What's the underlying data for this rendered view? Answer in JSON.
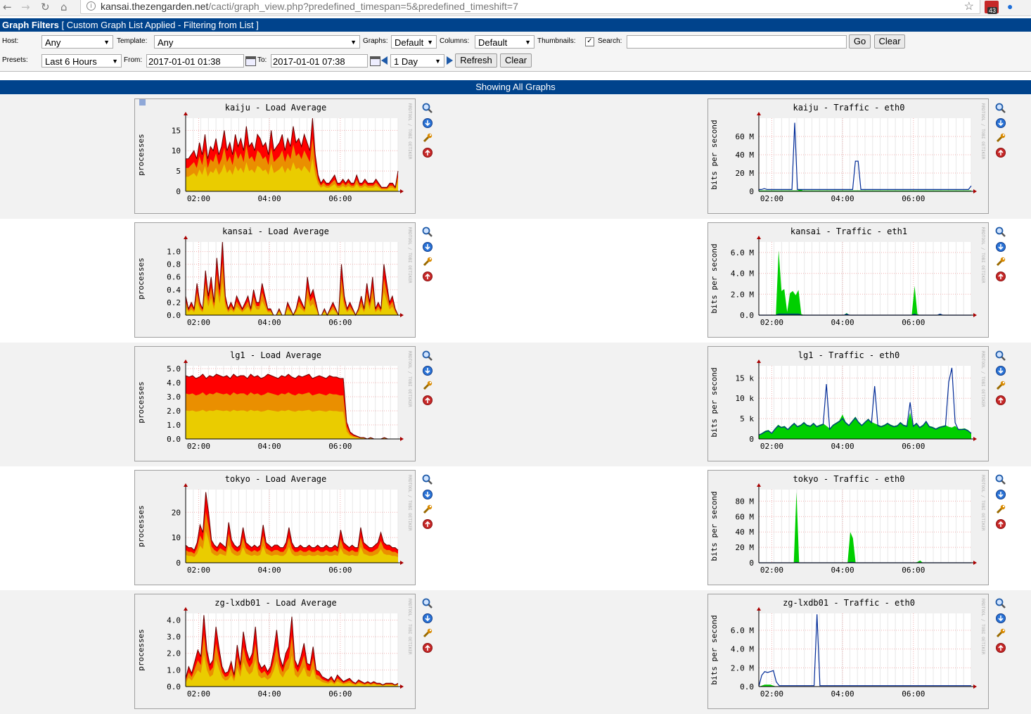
{
  "browser": {
    "url_host": "kansai.thezengarden.net",
    "url_path": "/cacti/graph_view.php?predefined_timespan=5&predefined_timeshift=7",
    "ext_badge": "43",
    "nav": {
      "back": "←",
      "forward": "→",
      "reload": "↻",
      "home": "⌂",
      "info": "i",
      "star": "☆"
    }
  },
  "filters": {
    "title": "Graph Filters",
    "subtitle": "[ Custom Graph List Applied - Filtering from List ]",
    "host_label": "Host:",
    "host_value": "Any",
    "template_label": "Template:",
    "template_value": "Any",
    "graphs_label": "Graphs:",
    "graphs_value": "Default",
    "columns_label": "Columns:",
    "columns_value": "Default",
    "thumbnails_label": "Thumbnails:",
    "thumbnails_checked": true,
    "search_label": "Search:",
    "search_value": "",
    "go_label": "Go",
    "clear_label": "Clear",
    "presets_label": "Presets:",
    "presets_value": "Last 6 Hours",
    "from_label": "From:",
    "from_value": "2017-01-01 01:38",
    "to_label": "To:",
    "to_value": "2017-01-01 07:38",
    "shift_value": "1 Day",
    "refresh_label": "Refresh",
    "clear2_label": "Clear"
  },
  "showing_label": "Showing All Graphs",
  "rrd_watermark": "RRDTOOL / TOBI OETIKER",
  "time_ticks": [
    "02:00",
    "04:00",
    "06:00"
  ],
  "colors": {
    "header": "#00438c",
    "load_red": "#ff0000",
    "load_orange": "#ea8f00",
    "load_yellow": "#eacc00",
    "traffic_in": "#00cf00",
    "traffic_out": "#002a97"
  },
  "icons": [
    "zoom-icon",
    "csv-export-icon",
    "edit-graph-icon",
    "top-icon"
  ],
  "graphs": [
    {
      "host": "kaiju",
      "left_title": "kaiju  -  Load Average",
      "right_title": "kaiju  -  Traffic  -  eth0",
      "left_ylabel": "processes",
      "right_ylabel": "bits per second",
      "left_ticks": [
        "0",
        "5",
        "10",
        "15"
      ],
      "left_ymax": 18,
      "right_ticks": [
        "0",
        "20 M",
        "40 M",
        "60 M"
      ],
      "right_ymax": 80,
      "load": [
        8,
        8,
        9,
        10,
        8,
        12,
        9,
        14,
        8,
        11,
        10,
        13,
        9,
        11,
        15,
        10,
        12,
        9,
        14,
        11,
        13,
        10,
        16,
        11,
        12,
        10,
        14,
        13,
        11,
        12,
        9,
        15,
        10,
        11,
        12,
        14,
        10,
        13,
        11,
        16,
        12,
        13,
        11,
        14,
        12,
        10,
        18,
        9,
        4,
        2,
        3,
        2,
        2,
        3,
        4,
        2,
        2,
        3,
        2,
        3,
        2,
        2,
        4,
        2,
        2,
        3,
        2,
        2,
        2,
        3,
        2,
        1,
        1,
        1,
        2,
        2,
        1,
        5
      ],
      "traffic_in": [
        1,
        1,
        1,
        1,
        1,
        1,
        1,
        1,
        1,
        1,
        1,
        1,
        1,
        1,
        1,
        2,
        1,
        1,
        1,
        1,
        1,
        1,
        1,
        1,
        1,
        1,
        1,
        1,
        1,
        1,
        1,
        1,
        1,
        1,
        1,
        1,
        1,
        1,
        1,
        1,
        1,
        1,
        1,
        1,
        1,
        1,
        1,
        1,
        1,
        1,
        1,
        1,
        1,
        1,
        1,
        1,
        1,
        1,
        1,
        1,
        1,
        1,
        1,
        1,
        1,
        1,
        1,
        1,
        1,
        1,
        1,
        1,
        1,
        1,
        1,
        1,
        1,
        1
      ],
      "traffic_out": [
        2,
        2,
        3,
        2,
        2,
        2,
        2,
        2,
        2,
        2,
        2,
        2,
        2,
        75,
        2,
        2,
        2,
        2,
        2,
        2,
        2,
        2,
        2,
        2,
        2,
        2,
        2,
        2,
        2,
        2,
        2,
        2,
        2,
        2,
        2,
        33,
        33,
        2,
        2,
        2,
        2,
        2,
        2,
        2,
        2,
        2,
        2,
        2,
        2,
        2,
        2,
        2,
        2,
        2,
        2,
        2,
        2,
        2,
        2,
        2,
        2,
        2,
        2,
        2,
        2,
        2,
        2,
        2,
        2,
        2,
        2,
        2,
        2,
        2,
        2,
        2,
        2,
        6
      ]
    },
    {
      "host": "kansai",
      "left_title": "kansai  -  Load Average",
      "right_title": "kansai  -  Traffic  -  eth1",
      "left_ylabel": "processes",
      "right_ylabel": "bits per second",
      "left_ticks": [
        "0.0",
        "0.2",
        "0.4",
        "0.6",
        "0.8",
        "1.0"
      ],
      "left_ymax": 1.15,
      "right_ticks": [
        "0.0",
        "2.0 M",
        "4.0 M",
        "6.0 M"
      ],
      "right_ymax": 7,
      "load": [
        0.3,
        0.1,
        0.2,
        0.1,
        0.5,
        0.2,
        0.1,
        0.7,
        0.3,
        0.6,
        0.2,
        0.9,
        0.4,
        1.15,
        0.3,
        0.1,
        0.2,
        0.1,
        0.3,
        0.2,
        0.1,
        0.2,
        0.3,
        0.1,
        0.4,
        0.2,
        0.2,
        0.5,
        0.3,
        0.1,
        0.1,
        0.0,
        0.0,
        0.1,
        0.0,
        0.0,
        0.2,
        0.1,
        0.0,
        0.1,
        0.3,
        0.2,
        0.1,
        0.6,
        0.3,
        0.4,
        0.2,
        0.0,
        0.0,
        0.1,
        0.0,
        0.1,
        0.2,
        0.1,
        0.0,
        0.8,
        0.3,
        0.1,
        0.2,
        0.1,
        0.0,
        0.1,
        0.3,
        0.1,
        0.5,
        0.2,
        0.6,
        0.1,
        0.2,
        0.1,
        0.8,
        0.5,
        0.2,
        0.3,
        0.1,
        0.0
      ],
      "traffic_in": [
        0,
        0,
        0,
        0,
        0,
        0,
        0,
        6.2,
        2.3,
        2.5,
        0.3,
        2.1,
        2.3,
        1.9,
        2.4,
        0.1,
        0.0,
        0.0,
        0.0,
        0.0,
        0.0,
        0.0,
        0.0,
        0.0,
        0.0,
        0.0,
        0.0,
        0.0,
        0.0,
        0.0,
        0.0,
        0.2,
        0.0,
        0.0,
        0.0,
        0.0,
        0.0,
        0.0,
        0.0,
        0.0,
        0.0,
        0.0,
        0.0,
        0.0,
        0.0,
        0.0,
        0.0,
        0.0,
        0.0,
        0.0,
        0.0,
        0.0,
        0.0,
        0.0,
        0.0,
        2.8,
        0.1,
        0.0,
        0.0,
        0.0,
        0.0,
        0.0,
        0.0,
        0.0,
        0.1,
        0.0,
        0.0,
        0.0,
        0.0,
        0.0,
        0.0,
        0.0,
        0.0,
        0.0,
        0.0,
        0.0
      ],
      "traffic_out": [
        0,
        0,
        0,
        0,
        0,
        0,
        0,
        0.1,
        0.1,
        0.1,
        0.1,
        0.1,
        0.1,
        0.1,
        0.1,
        0,
        0,
        0,
        0,
        0,
        0,
        0,
        0,
        0,
        0,
        0,
        0,
        0,
        0,
        0,
        0,
        0.1,
        0,
        0,
        0,
        0,
        0,
        0,
        0,
        0,
        0,
        0,
        0,
        0,
        0,
        0,
        0,
        0,
        0,
        0,
        0,
        0,
        0,
        0,
        0,
        0.1,
        0,
        0,
        0,
        0,
        0,
        0,
        0,
        0,
        0.1,
        0,
        0,
        0,
        0,
        0,
        0,
        0,
        0,
        0,
        0,
        0
      ]
    },
    {
      "host": "lg1",
      "left_title": "lg1  -  Load Average",
      "right_title": "lg1  -  Traffic  -  eth0",
      "left_ylabel": "processes",
      "right_ylabel": "bits per second",
      "left_ticks": [
        "0.0",
        "1.0",
        "2.0",
        "3.0",
        "4.0",
        "5.0"
      ],
      "left_ymax": 5.2,
      "right_ticks": [
        "0",
        "5  k",
        "10  k",
        "15  k"
      ],
      "right_ymax": 18,
      "load": [
        4.5,
        4.4,
        4.5,
        4.3,
        4.4,
        4.6,
        4.3,
        4.5,
        4.4,
        4.6,
        4.5,
        4.4,
        4.5,
        4.3,
        4.6,
        4.4,
        4.5,
        4.5,
        4.3,
        4.6,
        4.4,
        4.5,
        4.3,
        4.4,
        4.6,
        4.5,
        4.4,
        4.3,
        4.5,
        4.4,
        4.6,
        4.4,
        4.3,
        4.5,
        4.4,
        4.5,
        4.6,
        4.3,
        4.4,
        4.5,
        4.4,
        4.3,
        4.5,
        4.4,
        4.4,
        4.3,
        4.3,
        1.2,
        0.5,
        0.3,
        0.2,
        0.1,
        0.1,
        0.0,
        0.1,
        0.0,
        0.0,
        0.0,
        0.1,
        0.0,
        0.0,
        0.0,
        0.0
      ],
      "traffic_in": [
        1,
        1.5,
        2,
        2.2,
        1.5,
        2.6,
        3.5,
        3,
        3.2,
        2.5,
        3.3,
        4,
        3.2,
        3.5,
        4.2,
        3.5,
        3.3,
        4,
        3.2,
        3.5,
        3.8,
        3.2,
        2.6,
        3.5,
        4,
        4.5,
        6,
        4.2,
        3.5,
        4.5,
        5.5,
        4.3,
        3.5,
        4.3,
        5,
        4.2,
        3.8,
        3.5,
        3.2,
        3.5,
        4,
        3.5,
        3.2,
        3.4,
        4.2,
        3.5,
        3.3,
        6.5,
        3.3,
        4,
        3,
        3.5,
        4.5,
        3.2,
        3,
        2.6,
        3,
        3.2,
        3.4,
        3,
        2.8,
        3.2,
        2.5,
        2.5,
        2.6,
        2.2,
        1.5
      ],
      "traffic_out": [
        1,
        1.3,
        1.8,
        2,
        1.4,
        2.4,
        3.2,
        2.8,
        3,
        2.3,
        3.1,
        3.8,
        3,
        3.3,
        4,
        3.3,
        3.1,
        3.8,
        3,
        3.3,
        3.6,
        13.5,
        2.4,
        3.3,
        3.8,
        4.3,
        5,
        4,
        3.3,
        4.3,
        5.2,
        4.1,
        3.3,
        4.1,
        4.8,
        4,
        13,
        3.3,
        3,
        3.3,
        3.8,
        3.3,
        3,
        3.2,
        4,
        3.3,
        3.1,
        9,
        3.1,
        3.8,
        2.8,
        3.3,
        4.3,
        3,
        2.8,
        2.4,
        2.8,
        3,
        3.2,
        14,
        17.5,
        4,
        2.3,
        2.3,
        2.4,
        2,
        1.4
      ]
    },
    {
      "host": "tokyo",
      "left_title": "tokyo  -  Load Average",
      "right_title": "tokyo  -  Traffic  -  eth0",
      "left_ylabel": "processes",
      "right_ylabel": "bits per second",
      "left_ticks": [
        "0",
        "10",
        "20"
      ],
      "left_ymax": 29,
      "right_ticks": [
        "0",
        "20 M",
        "40 M",
        "60 M",
        "80 M"
      ],
      "right_ymax": 95,
      "load": [
        7,
        6,
        6,
        5,
        8,
        15,
        12,
        28,
        20,
        9,
        7,
        6,
        8,
        7,
        6,
        16,
        9,
        7,
        6,
        7,
        14,
        8,
        7,
        6,
        7,
        6,
        7,
        15,
        8,
        7,
        6,
        7,
        7,
        6,
        6,
        8,
        14,
        8,
        6,
        6,
        7,
        6,
        6,
        7,
        6,
        6,
        7,
        6,
        6,
        7,
        6,
        6,
        7,
        6,
        13,
        8,
        7,
        6,
        7,
        6,
        6,
        14,
        8,
        7,
        6,
        6,
        7,
        8,
        12,
        8,
        7,
        7,
        6,
        6,
        5
      ],
      "traffic_in": [
        0,
        0,
        0,
        0,
        0,
        0,
        0,
        0,
        0,
        0,
        0,
        0,
        0,
        0,
        92,
        0,
        0,
        0,
        0,
        0,
        0,
        0,
        0,
        0,
        0,
        0,
        0,
        0,
        0,
        0,
        0,
        0,
        0,
        0,
        40,
        32,
        0,
        0,
        0,
        0,
        0,
        0,
        0,
        0,
        0,
        0,
        0,
        0,
        0,
        0,
        0,
        0,
        0,
        0,
        0,
        0,
        0,
        0,
        0,
        1,
        3,
        0,
        0,
        0,
        0,
        0,
        0,
        0,
        0,
        0,
        0,
        0,
        0,
        0,
        0,
        0,
        0,
        0,
        0,
        0
      ],
      "traffic_out": [
        0,
        0,
        0,
        0,
        0,
        0,
        0,
        0,
        0,
        0,
        0,
        0,
        0,
        0,
        0.5,
        0,
        0,
        0,
        0,
        0,
        0,
        0,
        0,
        0,
        0,
        0,
        0,
        0,
        0,
        0,
        0,
        0,
        0,
        0,
        0.5,
        0.5,
        0,
        0,
        0,
        0,
        0,
        0,
        0,
        0,
        0,
        0,
        0,
        0,
        0,
        0,
        0,
        0,
        0,
        0,
        0,
        0,
        0,
        0,
        0,
        0,
        0,
        0,
        0,
        0,
        0,
        0,
        0,
        0,
        0,
        0,
        0,
        0,
        0,
        0,
        0,
        0,
        0,
        0,
        0,
        0
      ]
    },
    {
      "host": "zg-lxdb01",
      "left_title": "zg-lxdb01  -  Load Average",
      "right_title": "zg-lxdb01  -  Traffic  -  eth0",
      "left_ylabel": "processes",
      "right_ylabel": "bits per second",
      "left_ticks": [
        "0.0",
        "1.0",
        "2.0",
        "3.0",
        "4.0"
      ],
      "left_ymax": 4.4,
      "right_ticks": [
        "0.0",
        "2.0 M",
        "4.0 M",
        "6.0 M"
      ],
      "right_ymax": 7.8,
      "load": [
        0.5,
        1.2,
        0.8,
        1.5,
        2.2,
        1.8,
        4.3,
        2.2,
        1.3,
        1.6,
        3.6,
        2.3,
        1.2,
        0.8,
        0.9,
        1.5,
        0.7,
        2.5,
        1.3,
        3.3,
        2.2,
        1.6,
        2.0,
        3.6,
        1.5,
        1.1,
        1.3,
        0.9,
        1.2,
        2.1,
        3.4,
        1.8,
        1.2,
        2.0,
        2.4,
        4.2,
        1.6,
        1.2,
        1.8,
        2.6,
        1.4,
        1.3,
        2.4,
        1.0,
        0.9,
        0.6,
        0.5,
        0.4,
        0.6,
        0.3,
        0.7,
        0.5,
        0.3,
        0.4,
        0.5,
        0.3,
        0.2,
        0.4,
        0.3,
        0.2,
        0.3,
        0.2,
        0.3,
        0.2,
        0.2,
        0.1,
        0.2,
        0.2,
        0.2,
        0.1,
        0.2
      ],
      "traffic_in": [
        0,
        0.1,
        0.2,
        0.2,
        0.2,
        0.1,
        0,
        0,
        0,
        0,
        0,
        0,
        0,
        0,
        0,
        0,
        0,
        0,
        0,
        0,
        0,
        0,
        0,
        0,
        0,
        0,
        0,
        0,
        0,
        0,
        0,
        0,
        0,
        0,
        0,
        0,
        0,
        0,
        0,
        0,
        0,
        0,
        0,
        0,
        0,
        0,
        0,
        0,
        0,
        0,
        0,
        0,
        0,
        0,
        0,
        0,
        0,
        0,
        0,
        0,
        0,
        0,
        0,
        0,
        0,
        0,
        0,
        0,
        0,
        0,
        0,
        0,
        0,
        0
      ],
      "traffic_out": [
        0,
        1.2,
        1.6,
        1.5,
        1.6,
        1.7,
        0.5,
        0.1,
        0.1,
        0.1,
        0.1,
        0.1,
        0.1,
        0.1,
        0.1,
        0.1,
        0.1,
        0.1,
        0.1,
        0.1,
        7.7,
        0.1,
        0.1,
        0.1,
        0.1,
        0.1,
        0.1,
        0.1,
        0.1,
        0.1,
        0.1,
        0.1,
        0.1,
        0.1,
        0.1,
        0.1,
        0.1,
        0.1,
        0.1,
        0.1,
        0.1,
        0.1,
        0.1,
        0.1,
        0.1,
        0.1,
        0.1,
        0.1,
        0.1,
        0.1,
        0.1,
        0.1,
        0.1,
        0.1,
        0.1,
        0.1,
        0.1,
        0.1,
        0.1,
        0.1,
        0.1,
        0.1,
        0.1,
        0.1,
        0.1,
        0.1,
        0.1,
        0.1,
        0.1,
        0.1,
        0.1,
        0.1,
        0.1,
        0.1
      ]
    }
  ]
}
